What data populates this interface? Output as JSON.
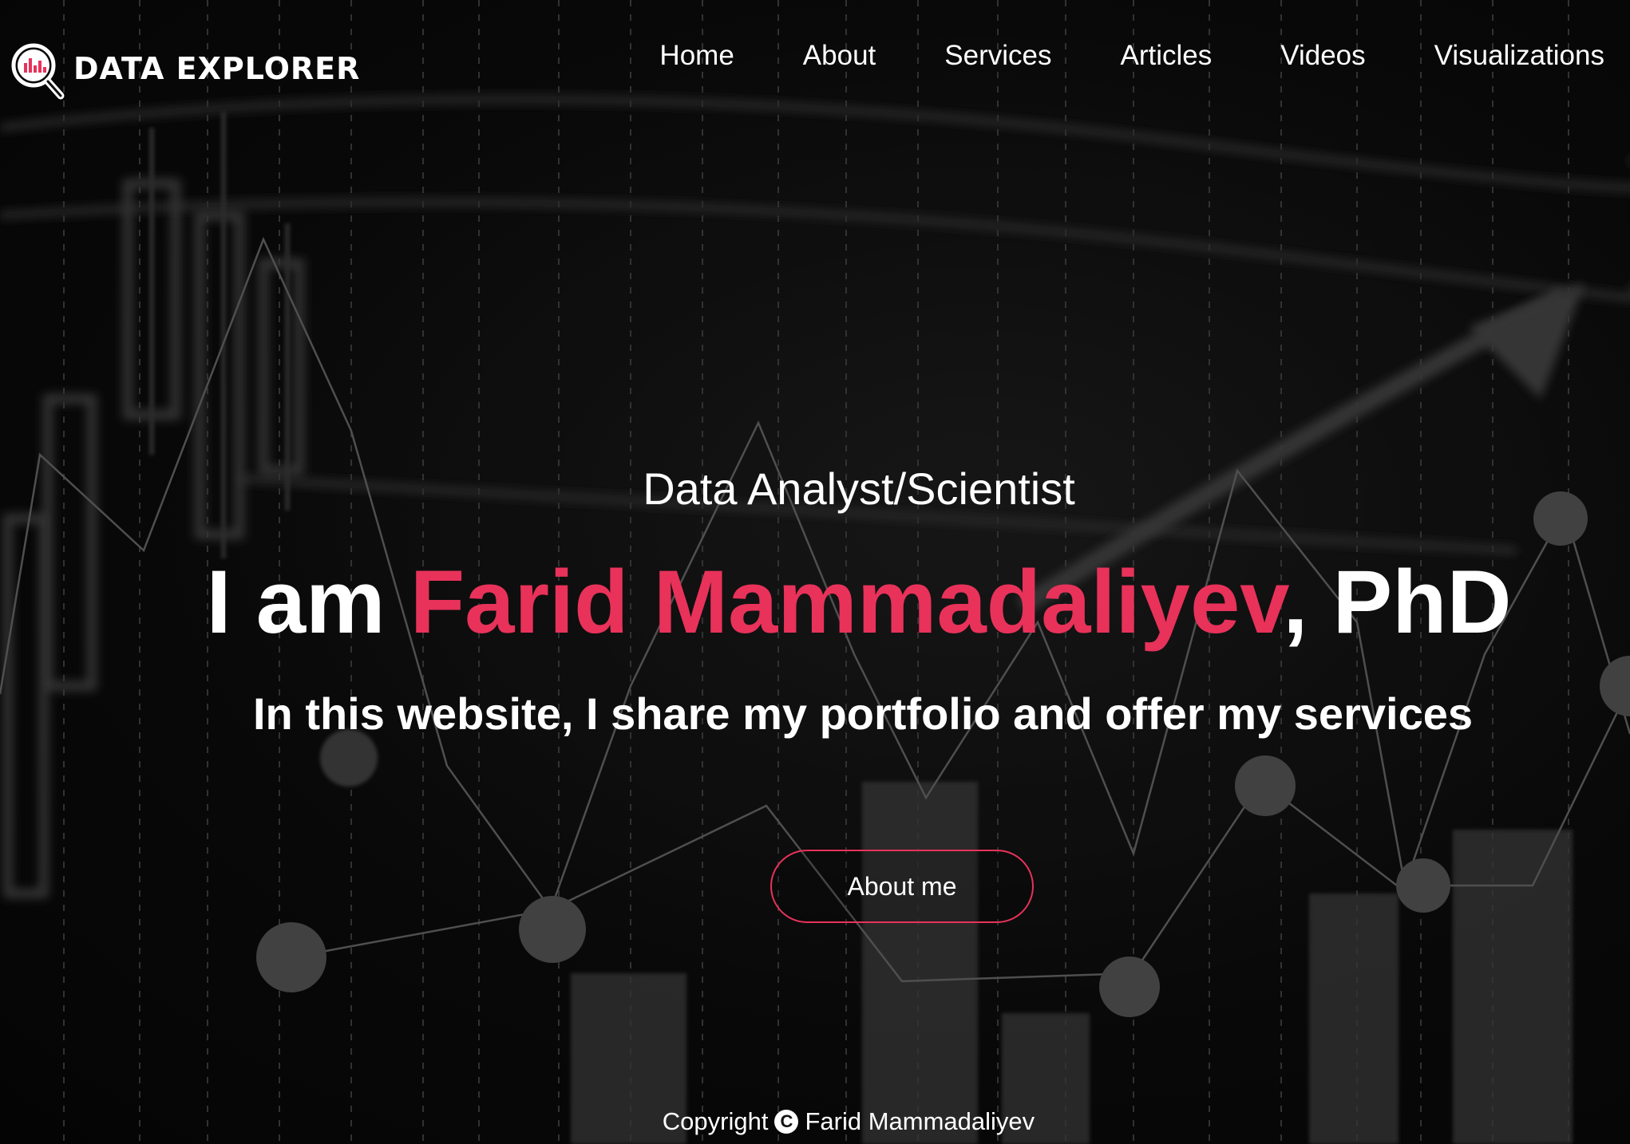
{
  "brand": {
    "logo_text": "DATA EXPLORER",
    "accent_color": "#e8325a",
    "icon": "magnifier-chart-icon"
  },
  "nav": {
    "items": [
      {
        "label": "Home"
      },
      {
        "label": "About"
      },
      {
        "label": "Services"
      },
      {
        "label": "Articles"
      },
      {
        "label": "Videos"
      },
      {
        "label": "Visualizations"
      }
    ]
  },
  "hero": {
    "subtitle": "Data Analyst/Scientist",
    "headline_prefix": "I am ",
    "headline_name": "Farid Mammadaliyev",
    "headline_suffix": ", PhD",
    "tagline": "In this website, I share my portfolio and offer my services",
    "cta_label": "About me"
  },
  "footer": {
    "copyright_label": "Copyright",
    "copyright_icon": "copyright-icon",
    "copyright_glyph": "C",
    "owner": "Farid Mammadaliyev"
  }
}
